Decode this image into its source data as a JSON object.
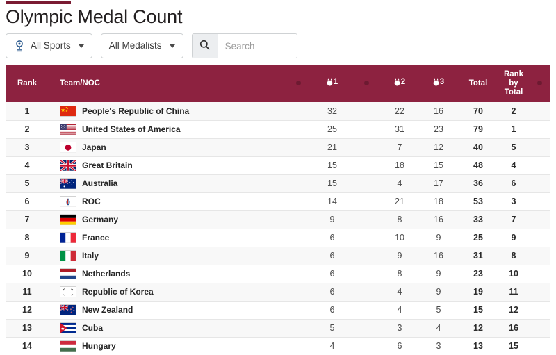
{
  "header": {
    "title": "Olympic Medal Count",
    "accent_color": "#7a1b32"
  },
  "toolbar": {
    "sports_filter": {
      "label": "All Sports",
      "icon": "olympic-torch-icon"
    },
    "medalists_filter": {
      "label": "All Medalists"
    },
    "search": {
      "placeholder": "Search",
      "value": "",
      "icon": "search-icon"
    }
  },
  "table": {
    "header_color": "#8d2240",
    "columns": {
      "rank": "Rank",
      "team": "Team/NOC",
      "gold": "1",
      "silver": "2",
      "bronze": "3",
      "total": "Total",
      "rank_by_total_line1": "Rank",
      "rank_by_total_line2": "by",
      "rank_by_total_line3": "Total"
    },
    "rows": [
      {
        "rank": "1",
        "team": "People's Republic of China",
        "flag": "cn",
        "gold": "32",
        "silver": "22",
        "bronze": "16",
        "total": "70",
        "rank_by_total": "2"
      },
      {
        "rank": "2",
        "team": "United States of America",
        "flag": "us",
        "gold": "25",
        "silver": "31",
        "bronze": "23",
        "total": "79",
        "rank_by_total": "1"
      },
      {
        "rank": "3",
        "team": "Japan",
        "flag": "jp",
        "gold": "21",
        "silver": "7",
        "bronze": "12",
        "total": "40",
        "rank_by_total": "5"
      },
      {
        "rank": "4",
        "team": "Great Britain",
        "flag": "gb",
        "gold": "15",
        "silver": "18",
        "bronze": "15",
        "total": "48",
        "rank_by_total": "4"
      },
      {
        "rank": "5",
        "team": "Australia",
        "flag": "au",
        "gold": "15",
        "silver": "4",
        "bronze": "17",
        "total": "36",
        "rank_by_total": "6"
      },
      {
        "rank": "6",
        "team": "ROC",
        "flag": "roc",
        "gold": "14",
        "silver": "21",
        "bronze": "18",
        "total": "53",
        "rank_by_total": "3"
      },
      {
        "rank": "7",
        "team": "Germany",
        "flag": "de",
        "gold": "9",
        "silver": "8",
        "bronze": "16",
        "total": "33",
        "rank_by_total": "7"
      },
      {
        "rank": "8",
        "team": "France",
        "flag": "fr",
        "gold": "6",
        "silver": "10",
        "bronze": "9",
        "total": "25",
        "rank_by_total": "9"
      },
      {
        "rank": "9",
        "team": "Italy",
        "flag": "it",
        "gold": "6",
        "silver": "9",
        "bronze": "16",
        "total": "31",
        "rank_by_total": "8"
      },
      {
        "rank": "10",
        "team": "Netherlands",
        "flag": "nl",
        "gold": "6",
        "silver": "8",
        "bronze": "9",
        "total": "23",
        "rank_by_total": "10"
      },
      {
        "rank": "11",
        "team": "Republic of Korea",
        "flag": "kr",
        "gold": "6",
        "silver": "4",
        "bronze": "9",
        "total": "19",
        "rank_by_total": "11"
      },
      {
        "rank": "12",
        "team": "New Zealand",
        "flag": "nz",
        "gold": "6",
        "silver": "4",
        "bronze": "5",
        "total": "15",
        "rank_by_total": "12"
      },
      {
        "rank": "13",
        "team": "Cuba",
        "flag": "cu",
        "gold": "5",
        "silver": "3",
        "bronze": "4",
        "total": "12",
        "rank_by_total": "16"
      },
      {
        "rank": "14",
        "team": "Hungary",
        "flag": "hu",
        "gold": "4",
        "silver": "6",
        "bronze": "3",
        "total": "13",
        "rank_by_total": "15"
      }
    ]
  }
}
